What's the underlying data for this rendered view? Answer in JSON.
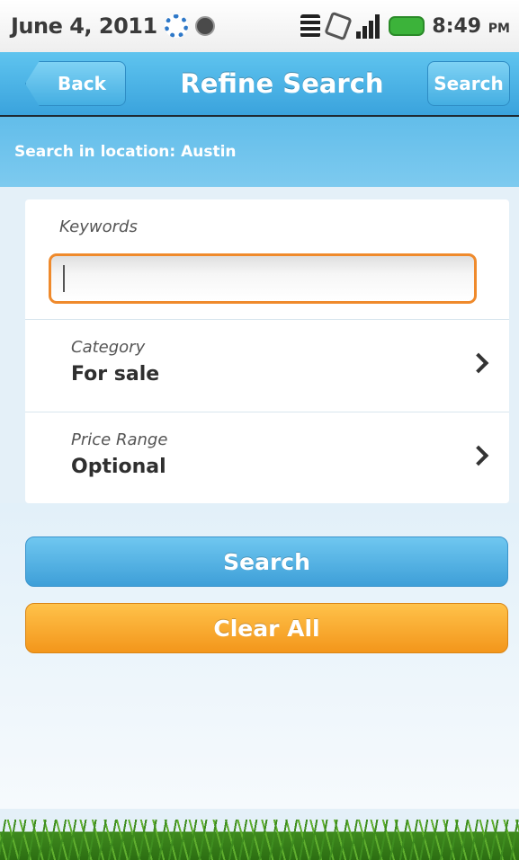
{
  "status_bar": {
    "date": "June 4, 2011",
    "time": "8:49",
    "ampm": "PM",
    "icons": [
      "sync-icon",
      "notification-icon",
      "wifi-icon",
      "phone-icon",
      "signal-icon",
      "battery-icon"
    ]
  },
  "header": {
    "back_label": "Back",
    "title": "Refine Search",
    "search_label": "Search"
  },
  "location_bar": {
    "text": "Search in location: Austin"
  },
  "form": {
    "keywords_label": "Keywords",
    "keywords_value": "",
    "category_label": "Category",
    "category_value": "For sale",
    "price_label": "Price Range",
    "price_value": "Optional"
  },
  "buttons": {
    "search_label": "Search",
    "clear_label": "Clear All"
  },
  "colors": {
    "header_blue": "#3aa3dd",
    "input_focus_orange": "#ef8a2c",
    "clear_orange": "#f3961b",
    "grass_green": "#3e8d1f"
  }
}
